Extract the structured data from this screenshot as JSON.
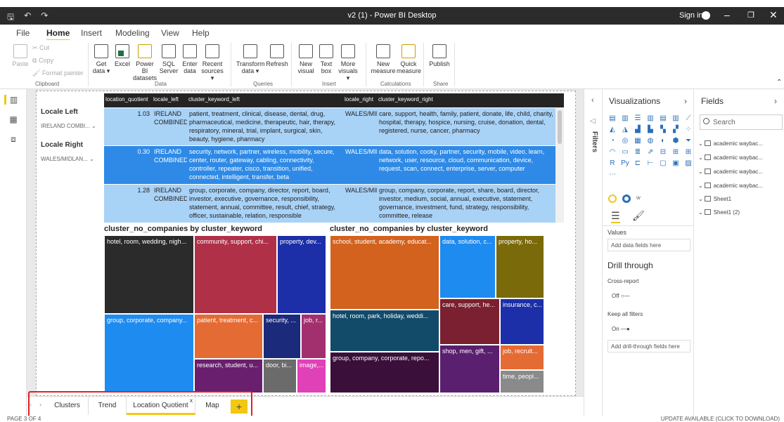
{
  "window": {
    "title": "v2 (1) - Power BI Desktop",
    "sign_in": "Sign in"
  },
  "menu": [
    "File",
    "Home",
    "Insert",
    "Modeling",
    "View",
    "Help"
  ],
  "ribbon": {
    "clipboard": {
      "paste": "Paste",
      "cut": "Cut",
      "copy": "Copy",
      "format_painter": "Format painter",
      "group": "Clipboard"
    },
    "data": {
      "items": [
        "Get data",
        "Excel",
        "Power BI datasets",
        "SQL Server",
        "Enter data",
        "Recent sources"
      ],
      "group": "Data"
    },
    "queries": {
      "items": [
        "Transform data",
        "Refresh"
      ],
      "group": "Queries"
    },
    "insert": {
      "items": [
        "New visual",
        "Text box",
        "More visuals"
      ],
      "group": "Insert"
    },
    "calculations": {
      "items": [
        "New measure",
        "Quick measure"
      ],
      "group": "Calculations"
    },
    "share": {
      "items": [
        "Publish"
      ],
      "group": "Share"
    }
  },
  "slicers": [
    {
      "label": "Locale Left",
      "value": "IRELAND COMBI..."
    },
    {
      "label": "Locale Right",
      "value": "WALES/MIDLAN..."
    }
  ],
  "table": {
    "headers": [
      "location_quotient",
      "locale_left",
      "cluster_keyword_left",
      "locale_right",
      "cluster_keyword_right"
    ],
    "rows": [
      {
        "lq": "1.03",
        "ll": "IRELAND COMBINED",
        "kl": "patient, treatment, clinical, disease, dental, drug, pharmaceutical, medicine, therapeutic, hair, therapy, respiratory, mineral, trial, implant, surgical, skin, beauty, hygiene, pharmacy",
        "lr": "WALES/MIDLANDS",
        "kr": "care, support, health, family, patient, donate, life, child, charity, hospital, therapy, hospice, nursing, cruise, donation, dental, registered, nurse, cancer, pharmacy"
      },
      {
        "lq": "0.30",
        "ll": "IRELAND COMBINED",
        "kl": "security, network, partner, wireless, mobility, secure, center, router, gateway, cabling, connectivity, controller, repeater, cisco, transition, unified, connected, intelligent, transfer, beta",
        "lr": "WALES/MIDLANDS",
        "kr": "data, solution, cooky, partner, security, mobile, video, learn, network, user, resource, cloud, communication, device, request, scan, connect, enterprise, server, computer"
      },
      {
        "lq": "1.28",
        "ll": "IRELAND COMBINED",
        "kl": "group, corporate, company, director, report, board, investor, executive, governance, responsibility, statement, annual, committee, result, chief, strategy, officer, sustainable, relation, responsible",
        "lr": "WALES/MIDLANDS",
        "kr": "group, company, corporate, report, share, board, director, investor, medium, social, annual, executive, statement, governance, investment, fund, strategy, responsibility, committee, release"
      }
    ]
  },
  "treemaps": [
    {
      "title": "cluster_no_companies by cluster_keyword",
      "tiles": [
        {
          "label": "hotel, room, wedding, nigh...",
          "color": "#2b2b2b"
        },
        {
          "label": "community, support, chi...",
          "color": "#b03048"
        },
        {
          "label": "property, dev...",
          "color": "#1c2fa8"
        },
        {
          "label": "group, corporate, company...",
          "color": "#1e8bf0"
        },
        {
          "label": "patient, treatment, c...",
          "color": "#e56b34"
        },
        {
          "label": "security, ...",
          "color": "#1b2a7a"
        },
        {
          "label": "job, r...",
          "color": "#a3306e"
        },
        {
          "label": "research, student, u...",
          "color": "#6a1f6e"
        },
        {
          "label": "door, bi...",
          "color": "#6b6b6b"
        },
        {
          "label": "image,...",
          "color": "#e040b8"
        }
      ]
    },
    {
      "title": "cluster_no_companies by cluster_keyword",
      "tiles": [
        {
          "label": "school, student, academy, educat...",
          "color": "#d2621e"
        },
        {
          "label": "data, solution, c...",
          "color": "#1e8bf0"
        },
        {
          "label": "property, ho...",
          "color": "#7a6a0a"
        },
        {
          "label": "care, support, he...",
          "color": "#7a2030"
        },
        {
          "label": "insurance, c...",
          "color": "#1c2fa8"
        },
        {
          "label": "hotel, room, park, holiday, weddi...",
          "color": "#124a6a"
        },
        {
          "label": "shop, men, gift, ...",
          "color": "#5a1f6e"
        },
        {
          "label": "job, recruit...",
          "color": "#e56b34"
        },
        {
          "label": "group, company, corporate, repo...",
          "color": "#3a0f3a"
        },
        {
          "label": "time, peopl...",
          "color": "#8a8a8a"
        }
      ]
    }
  ],
  "tabs": [
    "Clusters",
    "Trend",
    "Location Quotient",
    "Map"
  ],
  "status": {
    "page": "PAGE 3 OF 4",
    "update": "UPDATE AVAILABLE (CLICK TO DOWNLOAD)"
  },
  "filters_label": "Filters",
  "visualizations": {
    "title": "Visualizations",
    "values_label": "Values",
    "values_well": "Add data fields here",
    "drill_title": "Drill through",
    "cross_report": "Cross-report",
    "cross_state": "Off",
    "keep_filters": "Keep all filters",
    "keep_state": "On",
    "drill_well": "Add drill-through fields here"
  },
  "fields": {
    "title": "Fields",
    "search_placeholder": "Search",
    "items": [
      "academic waybac...",
      "academic waybac...",
      "academic waybac...",
      "academic waybac...",
      "Sheet1",
      "Sheet1 (2)"
    ]
  },
  "colors": {
    "accent": "#f2c811",
    "row_a": "#a9d2f7",
    "row_b": "#2e8ae6",
    "highlight": "#e02020"
  }
}
